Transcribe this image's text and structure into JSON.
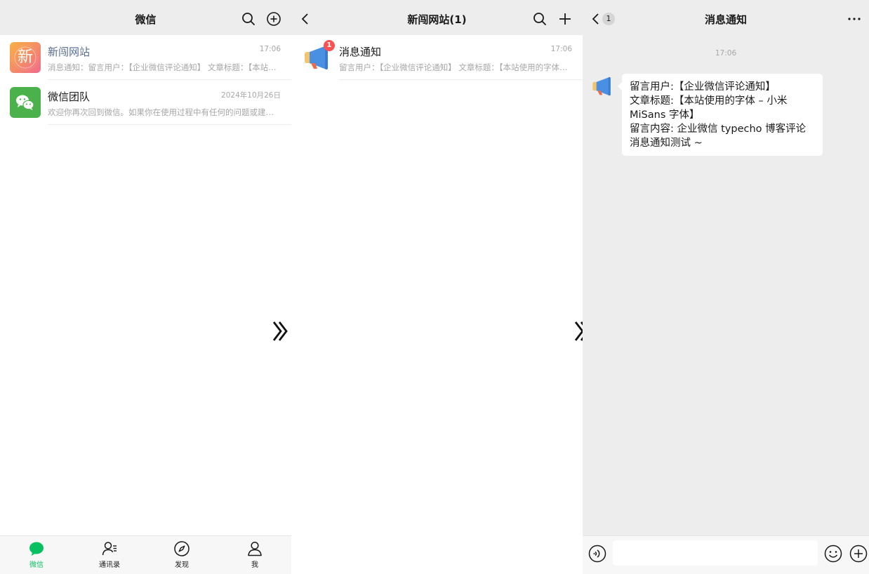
{
  "panel1": {
    "title": "微信",
    "chats": [
      {
        "name": "新闯网站",
        "time": "17:06",
        "preview": "消息通知：留言用户：【企业微信评论通知】 文章标题：【本站使用的字体 – 小米MiSans字体】",
        "avatar_char": "新"
      },
      {
        "name": "微信团队",
        "time": "2024年10月26日",
        "preview": "欢迎你再次回到微信。如果你在使用过程中有任何的问题或建议，记得给我发信息反馈哦。"
      }
    ],
    "tabs": [
      {
        "label": "微信"
      },
      {
        "label": "通讯录"
      },
      {
        "label": "发现"
      },
      {
        "label": "我"
      }
    ]
  },
  "panel2": {
    "title": "新闯网站(1)",
    "item": {
      "name": "消息通知",
      "time": "17:06",
      "preview": "留言用户：【企业微信评论通知】 文章标题：【本站使用的字体 – 小米MiSans字体】",
      "badge": "1"
    }
  },
  "panel3": {
    "title": "消息通知",
    "back_badge": "1",
    "time": "17:06",
    "message": {
      "line1": "留言用户:【企业微信评论通知】",
      "line2": "文章标题:【本站使用的字体 – 小米MiSans 字体】",
      "line3": "留言内容: 企业微信 typecho 博客评论消息通知测试 ~"
    },
    "input_value": ""
  },
  "colors": {
    "accent": "#07c160",
    "header_bg": "#ededed",
    "badge_red": "#fa5151",
    "link_name": "#576b95"
  },
  "icons": [
    "search-icon",
    "add-circle-icon",
    "back-icon",
    "plus-icon",
    "more-icon",
    "voice-icon",
    "emoji-icon",
    "add-icon",
    "chevron-double-right-icon",
    "megaphone-icon",
    "wechat-logo-icon"
  ]
}
